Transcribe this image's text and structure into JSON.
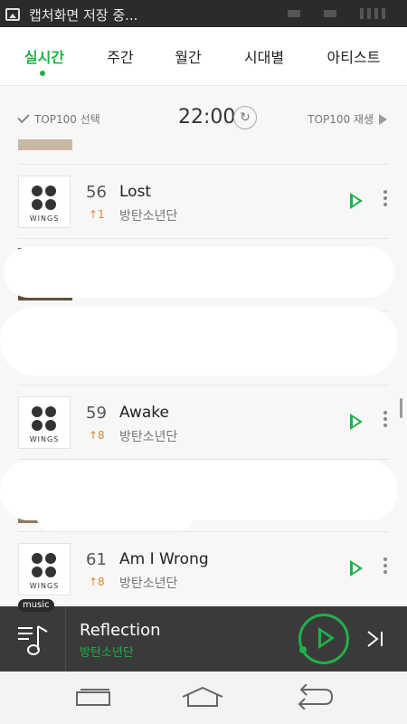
{
  "status_bar": {
    "notification_text": "캡처화면 저장 중..."
  },
  "tabs": [
    "실시간",
    "주간",
    "월간",
    "시대별",
    "아티스트"
  ],
  "toolbar": {
    "select_label": "TOP100 선택",
    "time": "22:00",
    "play_label": "TOP100 재생"
  },
  "rows": [
    {
      "rank": "56",
      "change": "↑1",
      "title": "Lost",
      "artist": "방탄소년단",
      "album_text": "WINGS"
    },
    {
      "rank": "59",
      "change": "↑8",
      "title": "Awake",
      "artist": "방탄소년단",
      "album_text": "WINGS"
    },
    {
      "rank": "61",
      "change": "↑8",
      "title": "Am I Wrong",
      "artist": "방탄소년단",
      "album_text": "WINGS"
    }
  ],
  "player": {
    "badge": "music",
    "title": "Reflection",
    "artist": "방탄소년단"
  },
  "colors": {
    "accent": "#1fb24a",
    "rank_change": "#e0892c",
    "player_bg": "#3a3a3a"
  },
  "icons": [
    "image-icon",
    "check-icon",
    "refresh-icon",
    "play-all-icon",
    "play-icon",
    "more-icon",
    "music-note-icon",
    "next-track-icon",
    "recent-apps-icon",
    "home-icon",
    "back-icon"
  ]
}
